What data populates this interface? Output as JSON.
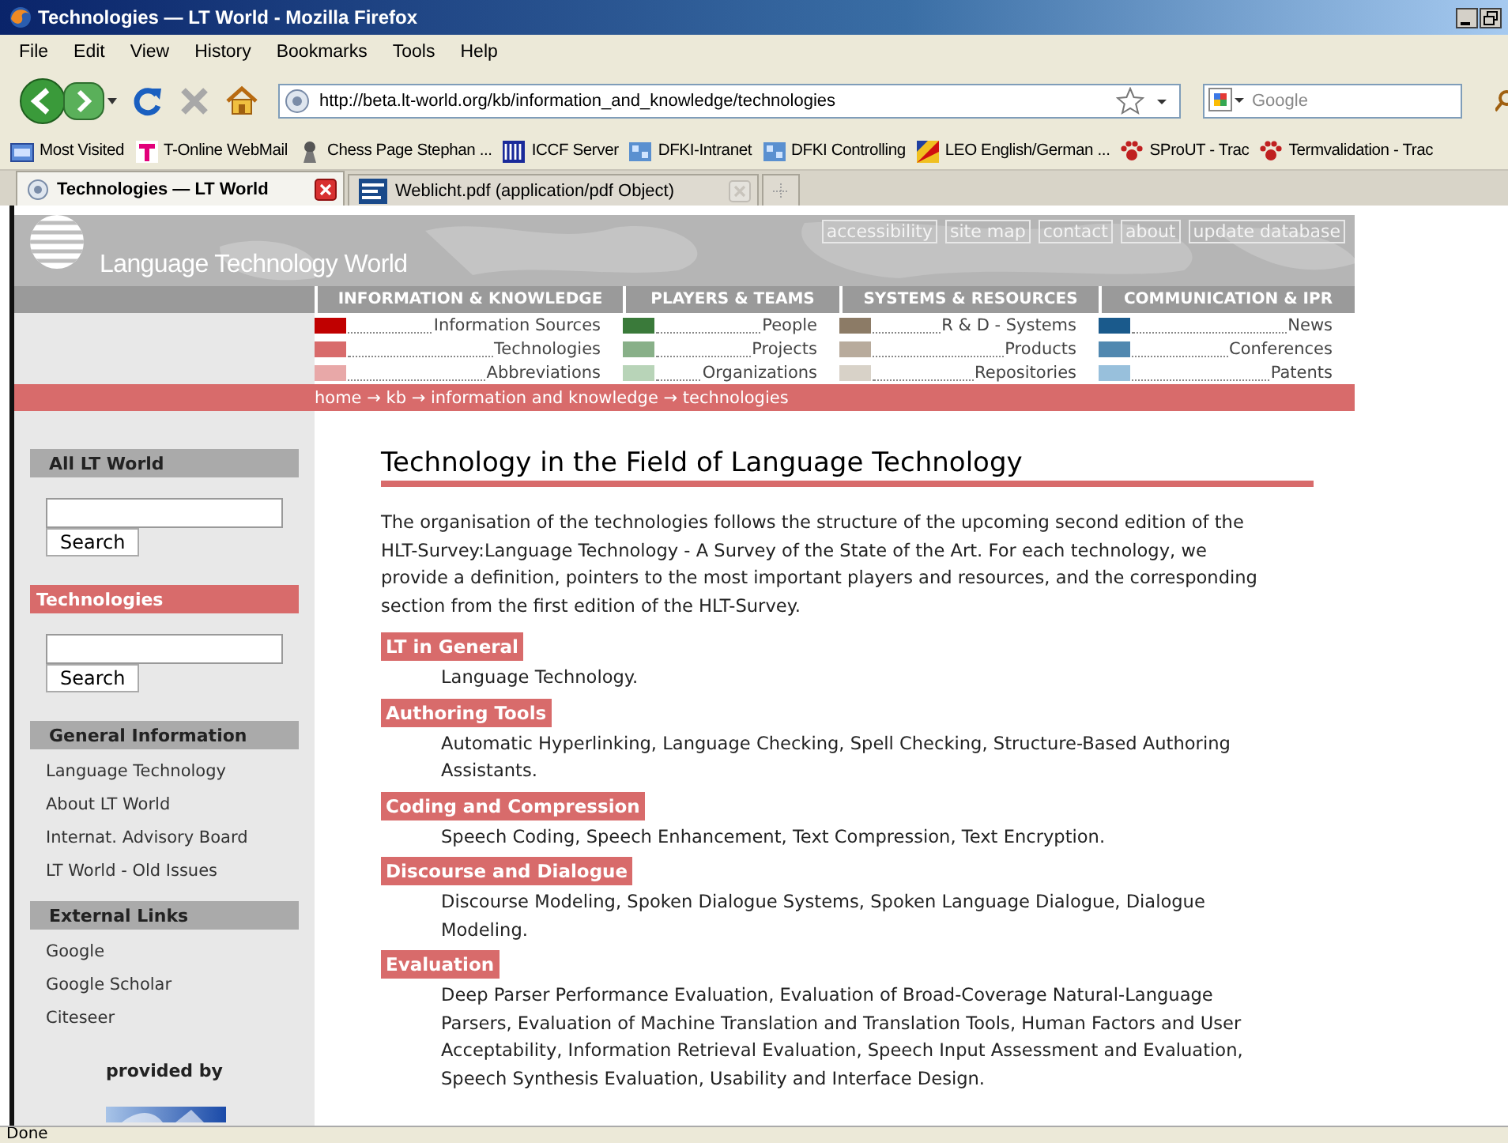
{
  "window": {
    "title": "Technologies — LT World - Mozilla Firefox"
  },
  "menu": [
    "File",
    "Edit",
    "View",
    "History",
    "Bookmarks",
    "Tools",
    "Help"
  ],
  "address": {
    "url": "http://beta.lt-world.org/kb/information_and_knowledge/technologies"
  },
  "search": {
    "placeholder": "Google"
  },
  "bookmarks": [
    {
      "label": "Most Visited",
      "kind": "folder"
    },
    {
      "label": "T-Online WebMail",
      "kind": "t"
    },
    {
      "label": "Chess Page Stephan ...",
      "kind": "chess"
    },
    {
      "label": "ICCF Server",
      "kind": "iccf"
    },
    {
      "label": "DFKI-Intranet",
      "kind": "net"
    },
    {
      "label": "DFKI Controlling",
      "kind": "net"
    },
    {
      "label": "LEO English/German ...",
      "kind": "leo"
    },
    {
      "label": "SProUT - Trac",
      "kind": "paw"
    },
    {
      "label": "Termvalidation - Trac",
      "kind": "paw"
    }
  ],
  "tabs": [
    {
      "label": "Technologies — LT World",
      "selected": true,
      "kind": "page"
    },
    {
      "label": "Weblicht.pdf (application/pdf Object)",
      "selected": false,
      "kind": "pdf"
    }
  ],
  "site": {
    "title": "Language Technology World",
    "top_links": [
      "accessibility",
      "site map",
      "contact",
      "about",
      "update database"
    ]
  },
  "nav": [
    {
      "title": "INFORMATION & KNOWLEDGE",
      "items": [
        {
          "label": "Information Sources",
          "color": "#c00000"
        },
        {
          "label": "Technologies",
          "color": "#d86b6b"
        },
        {
          "label": "Abbreviations",
          "color": "#e8a8a8"
        }
      ]
    },
    {
      "title": "PLAYERS & TEAMS",
      "items": [
        {
          "label": "People",
          "color": "#3a7a3a"
        },
        {
          "label": "Projects",
          "color": "#88b088"
        },
        {
          "label": "Organizations",
          "color": "#b8d4b8"
        }
      ]
    },
    {
      "title": "SYSTEMS & RESOURCES",
      "items": [
        {
          "label": "R & D - Systems",
          "color": "#8c7b66"
        },
        {
          "label": "Products",
          "color": "#b8ab9c"
        },
        {
          "label": "Repositories",
          "color": "#d8d2c8"
        }
      ]
    },
    {
      "title": "COMMUNICATION & IPR",
      "items": [
        {
          "label": "News",
          "color": "#1a5a8c"
        },
        {
          "label": "Conferences",
          "color": "#5088b0"
        },
        {
          "label": "Patents",
          "color": "#98c0dc"
        }
      ]
    }
  ],
  "breadcrumb": "home → kb → information and knowledge → technologies",
  "sidebar": [
    {
      "title": "All LT World",
      "selected": false,
      "kind": "search",
      "button": "Search"
    },
    {
      "title": "Technologies",
      "selected": true,
      "kind": "search",
      "button": "Search"
    },
    {
      "title": "General Information",
      "selected": false,
      "kind": "links",
      "links": [
        "Language Technology",
        "About LT World",
        "Internat. Advisory Board",
        "LT World - Old Issues"
      ]
    },
    {
      "title": "External Links",
      "selected": false,
      "kind": "links",
      "links": [
        "Google",
        "Google Scholar",
        "Citeseer"
      ]
    }
  ],
  "provided_by": "provided by",
  "main": {
    "heading": "Technology in the Field of Language Technology",
    "intro": "The organisation of the technologies follows the structure of the upcoming second edition of the HLT-Survey:Language Technology - A Survey of the State of the Art. For each technology, we provide a definition, pointers to the most important players and resources, and the corresponding section from the first edition of the HLT-Survey.",
    "topics": [
      {
        "title": "LT in General",
        "description": "Language Technology."
      },
      {
        "title": "Authoring Tools",
        "description": "Automatic Hyperlinking, Language Checking, Spell Checking, Structure-Based Authoring Assistants."
      },
      {
        "title": "Coding and Compression",
        "description": "Speech Coding, Speech Enhancement, Text Compression, Text Encryption."
      },
      {
        "title": "Discourse and Dialogue",
        "description": "Discourse Modeling, Spoken Dialogue Systems, Spoken Language Dialogue, Dialogue Modeling."
      },
      {
        "title": "Evaluation",
        "description": "Deep Parser Performance Evaluation, Evaluation of Broad-Coverage Natural-Language Parsers, Evaluation of Machine Translation and Translation Tools, Human Factors and User Acceptability, Information Retrieval Evaluation, Speech Input Assessment and Evaluation, Speech Synthesis Evaluation, Usability and Interface Design."
      }
    ]
  },
  "status_bar": "Done"
}
